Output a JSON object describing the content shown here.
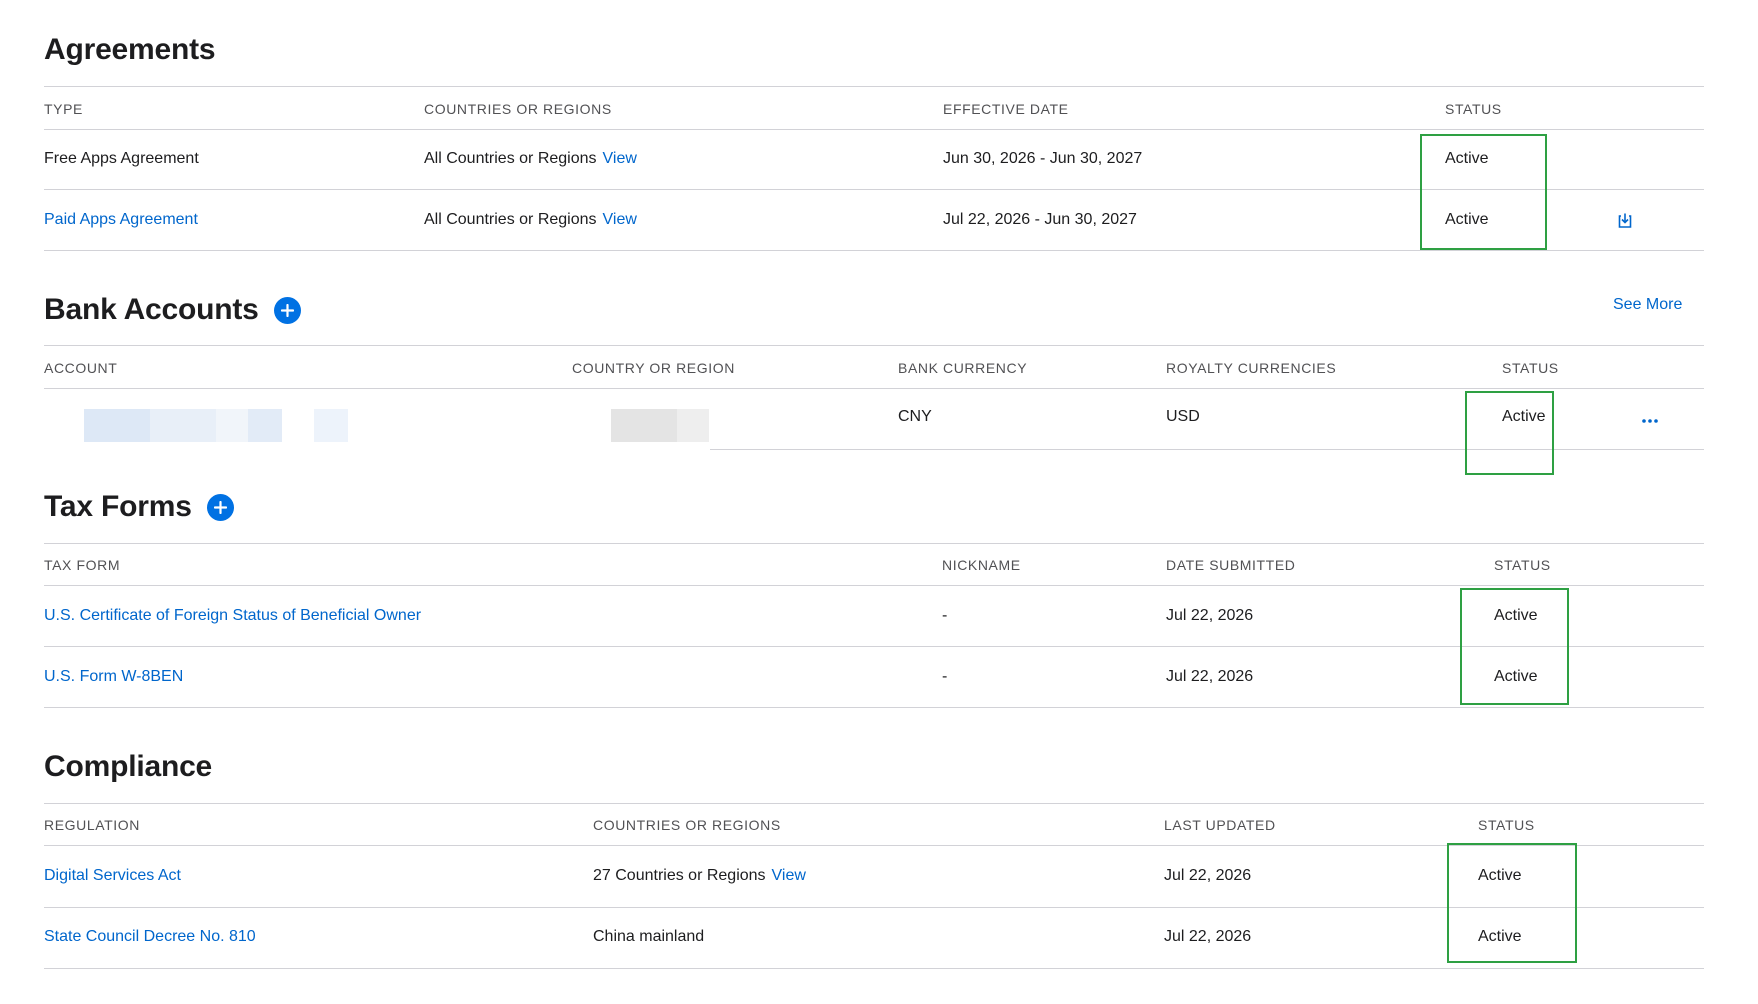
{
  "agreements": {
    "title": "Agreements",
    "headers": [
      "TYPE",
      "COUNTRIES OR REGIONS",
      "EFFECTIVE DATE",
      "STATUS"
    ],
    "rows": [
      {
        "type": "Free Apps Agreement",
        "countries": "All Countries or Regions",
        "view_label": "View",
        "date": "Jun 30, 2026 - Jun 30, 2027",
        "status": "Active"
      },
      {
        "type": "Paid Apps Agreement",
        "countries": "All Countries or Regions",
        "view_label": "View",
        "date": "Jul 22, 2026 - Jun 30, 2027",
        "status": "Active",
        "action_icon": "download-icon"
      }
    ]
  },
  "bank": {
    "title": "Bank Accounts",
    "add_icon": "plus-icon",
    "see_more": "See More",
    "headers": [
      "ACCOUNT",
      "COUNTRY OR REGION",
      "BANK CURRENCY",
      "ROYALTY CURRENCIES",
      "STATUS"
    ],
    "rows": [
      {
        "account": "",
        "country": "",
        "bank_currency": "CNY",
        "royalty": "USD",
        "status": "Active",
        "action_icon": "more-icon"
      }
    ]
  },
  "tax": {
    "title": "Tax Forms",
    "add_icon": "plus-icon",
    "headers": [
      "TAX FORM",
      "NICKNAME",
      "DATE SUBMITTED",
      "STATUS"
    ],
    "rows": [
      {
        "form": "U.S. Certificate of Foreign Status of Beneficial Owner",
        "nickname": "-",
        "date": "Jul 22, 2026",
        "status": "Active"
      },
      {
        "form": "U.S. Form W-8BEN",
        "nickname": "-",
        "date": "Jul 22, 2026",
        "status": "Active"
      }
    ]
  },
  "compliance": {
    "title": "Compliance",
    "headers": [
      "REGULATION",
      "COUNTRIES OR REGIONS",
      "LAST UPDATED",
      "STATUS"
    ],
    "rows": [
      {
        "regulation": "Digital Services Act",
        "countries": "27 Countries or Regions",
        "view_label": "View",
        "date": "Jul 22, 2026",
        "status": "Active"
      },
      {
        "regulation": "State Council Decree No. 810",
        "countries": "China mainland",
        "date": "Jul 22, 2026",
        "status": "Active"
      }
    ]
  },
  "colors": {
    "accent": "#0071e3",
    "link": "#0066cc",
    "highlight": "#2ea043",
    "rule": "#d2d2d7"
  }
}
